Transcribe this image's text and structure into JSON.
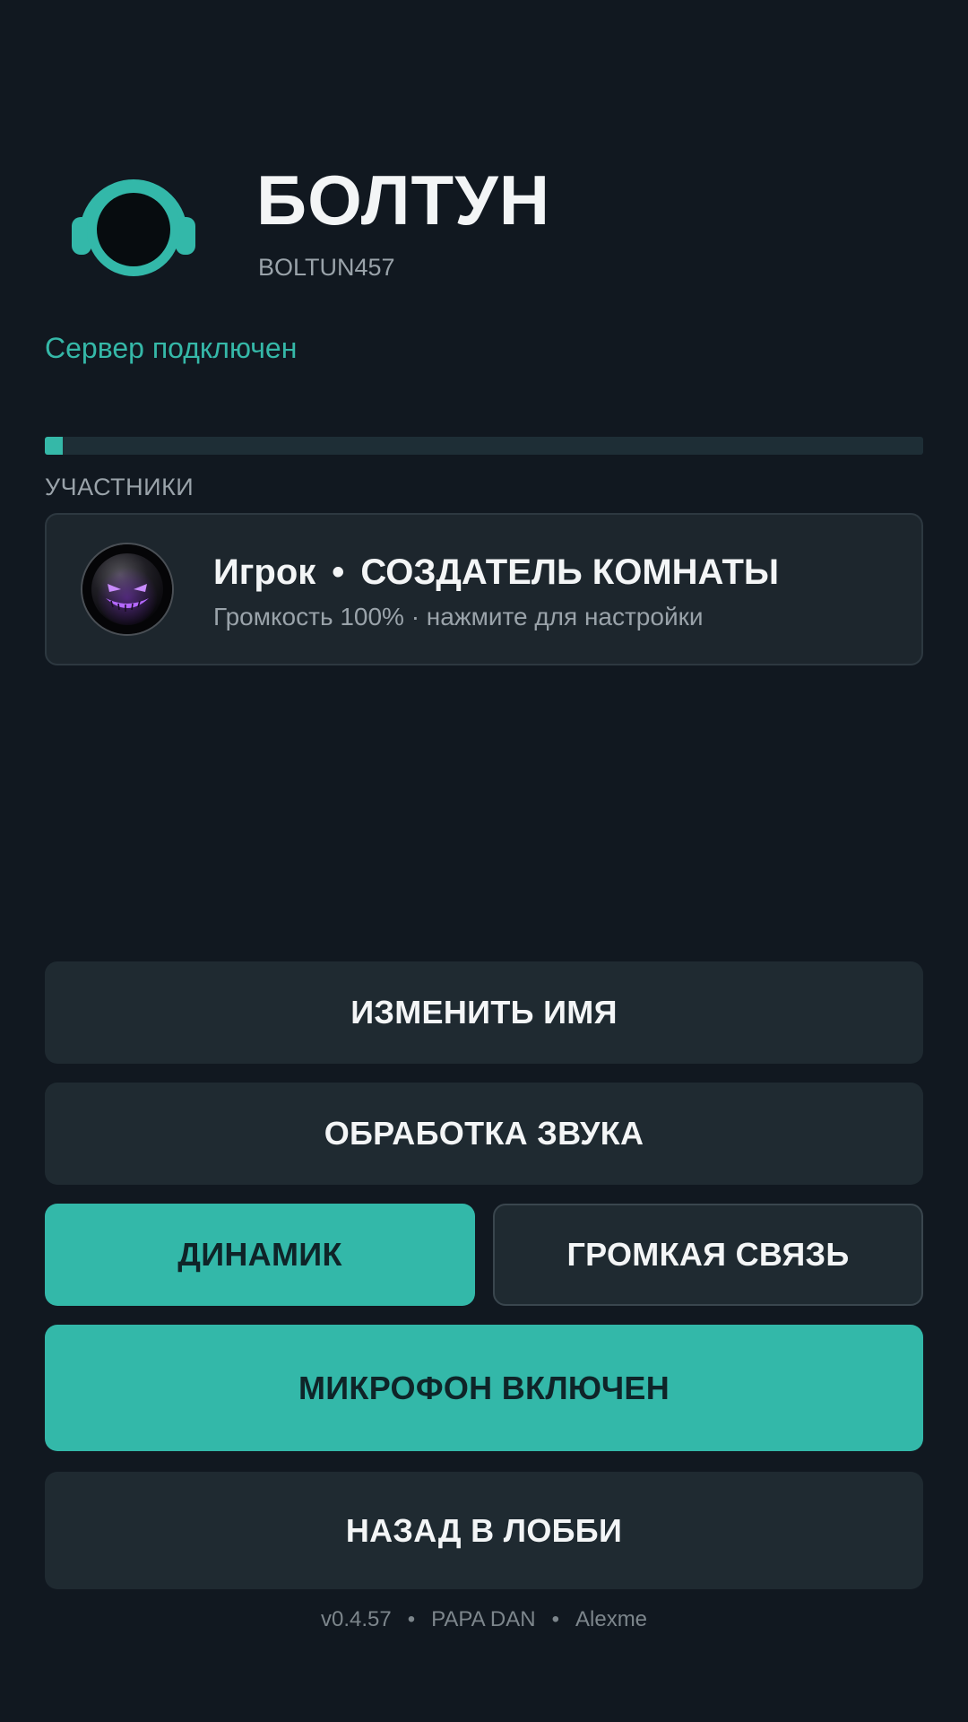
{
  "header": {
    "title": "БОЛТУН",
    "room_code": "BOLTUN457",
    "logo_icon": "headphones-icon"
  },
  "status": {
    "server": "Сервер подключен"
  },
  "audio_level": {
    "fraction": 0.003
  },
  "participants": {
    "section_label": "УЧАСТНИКИ",
    "items": [
      {
        "name": "Игрок",
        "separator": "•",
        "role": "СОЗДАТЕЛЬ КОМНАТЫ",
        "subtitle": "Громкость 100% · нажмите для настройки",
        "avatar_icon": "grinning-face-avatar-icon"
      }
    ]
  },
  "actions": {
    "rename": "ИЗМЕНИТЬ ИМЯ",
    "sound_processing": "ОБРАБОТКА ЗВУКА",
    "speaker": "ДИНАМИК",
    "loudspeaker": "ГРОМКАЯ СВЯЗЬ",
    "microphone": "МИКРОФОН ВКЛЮЧЕН",
    "back_to_lobby": "НАЗАД В ЛОББИ"
  },
  "footer": {
    "version": "v0.4.57",
    "separator": "•",
    "author1": "PAPA DAN",
    "author2": "Alexme"
  },
  "colors": {
    "background": "#111820",
    "accent": "#33b8a9",
    "card": "#1f2a31",
    "text_primary": "#f3f5f6",
    "text_secondary": "#9aa3aa"
  }
}
